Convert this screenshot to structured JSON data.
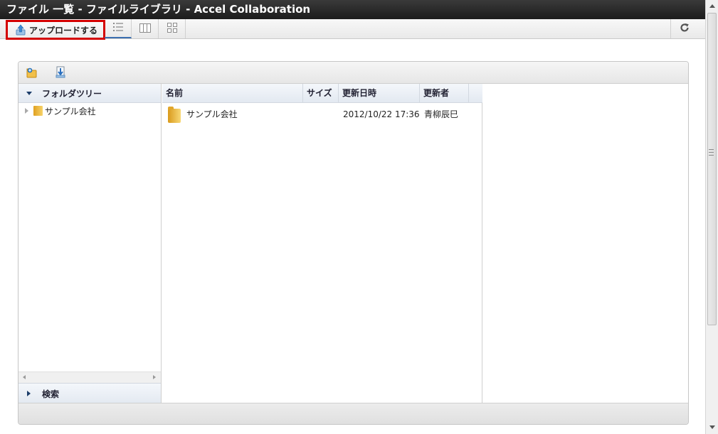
{
  "window": {
    "title": "ファイル 一覧 - ファイルライブラリ - Accel Collaboration"
  },
  "toolbar": {
    "upload_label": "アップロードする",
    "view_buttons": [
      "list-view-icon",
      "column-view-icon",
      "thumbnail-view-icon"
    ],
    "refresh_icon": "refresh-icon",
    "highlight_color": "#d40000"
  },
  "panel": {
    "toolbar_icons": [
      "new-folder-icon",
      "download-icon"
    ]
  },
  "tree": {
    "header": "フォルダツリー",
    "nodes": [
      {
        "label": "サンプル会社",
        "expanded": false
      }
    ],
    "search_label": "検索"
  },
  "files": {
    "columns": [
      "名前",
      "サイズ",
      "更新日時",
      "更新者"
    ],
    "rows": [
      {
        "name": "サンプル会社",
        "size": "",
        "updated": "2012/10/22 17:36",
        "updater": "青柳辰巳"
      }
    ]
  }
}
